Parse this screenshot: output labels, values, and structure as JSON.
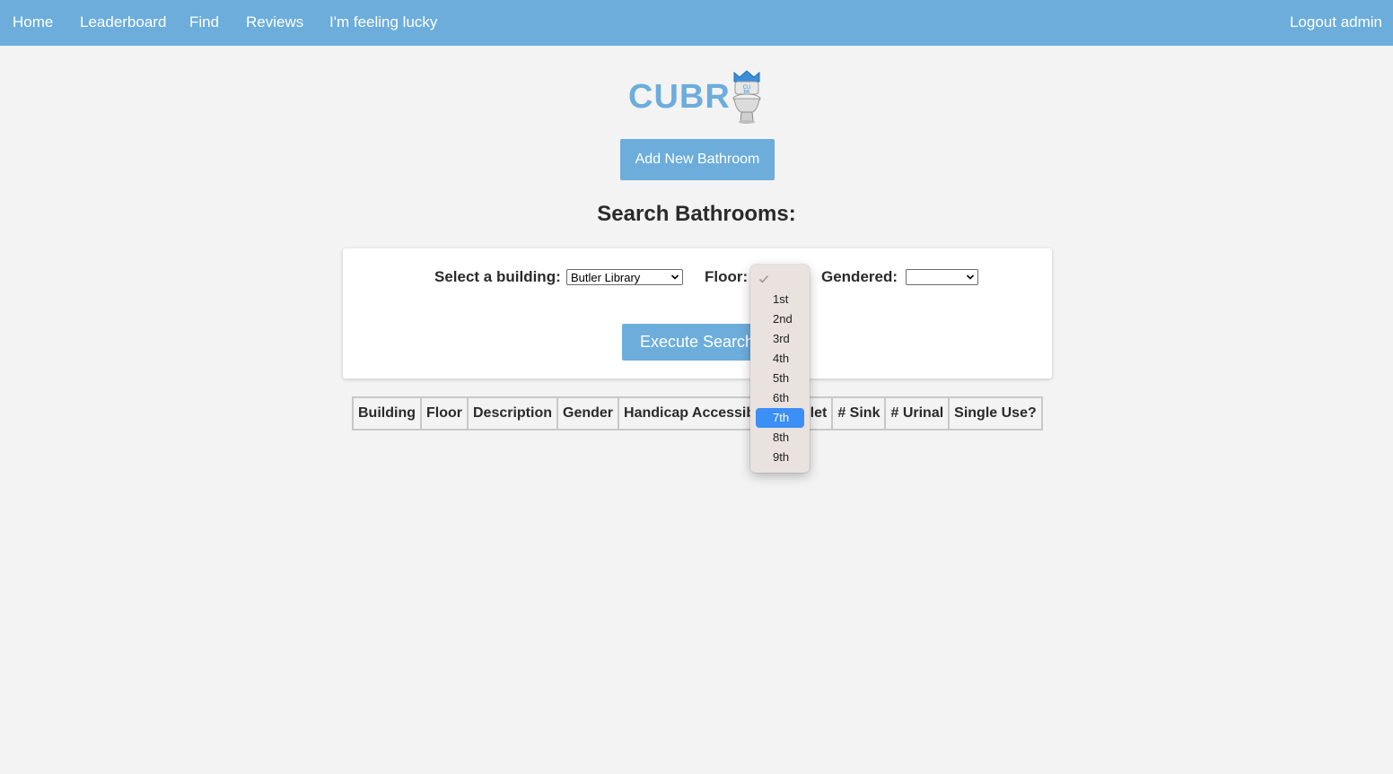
{
  "nav": {
    "home": "Home",
    "leaderboard": "Leaderboard",
    "find": "Find",
    "reviews": "Reviews",
    "lucky": "I'm feeling lucky",
    "logout": "Logout admin"
  },
  "brand": {
    "name": "CUBR",
    "icon": "toilet-crown-logo"
  },
  "add_button": "Add New Bathroom",
  "search": {
    "title": "Search Bathrooms:",
    "building_label": "Select a building:",
    "building_value": "Butler Library",
    "floor_label": "Floor:",
    "gendered_label": "Gendered:",
    "gendered_value": "",
    "execute_button": "Execute Search"
  },
  "table": {
    "headers": [
      "Building",
      "Floor",
      "Description",
      "Gender",
      "Handicap Accessible",
      "# Toilet",
      "# Sink",
      "# Urinal",
      "Single Use?"
    ]
  },
  "floor_dropdown": {
    "options": [
      "",
      "1st",
      "2nd",
      "3rd",
      "4th",
      "5th",
      "6th",
      "7th",
      "8th",
      "9th"
    ],
    "highlighted": "7th"
  },
  "colors": {
    "accent": "#6caddb",
    "highlight": "#3b8ff5",
    "background": "#f3f3f3"
  }
}
